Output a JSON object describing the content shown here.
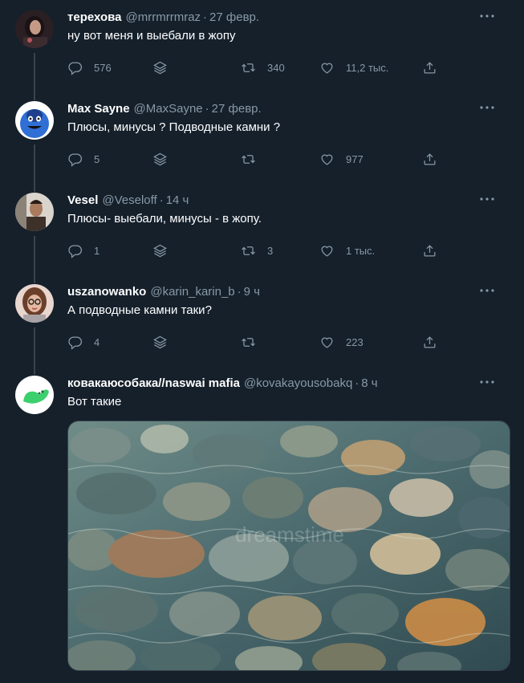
{
  "tweets": [
    {
      "display_name": "терехова",
      "handle": "@mrrmrrmraz",
      "dot": "·",
      "time": "27 февр.",
      "text": "ну вот меня и выебали в жопу",
      "reply_count": "576",
      "retweet_count": "340",
      "like_count": "11,2 тыс.",
      "avatar_color": "#3a2b2b"
    },
    {
      "display_name": "Max Sayne",
      "handle": "@MaxSayne",
      "dot": "·",
      "time": "27 февр.",
      "text": "Плюсы, минусы ? Подводные камни ?",
      "reply_count": "5",
      "retweet_count": "",
      "like_count": "977",
      "avatar_color": "#2f6fd6"
    },
    {
      "display_name": "Vesel",
      "handle": "@Veseloff",
      "dot": "·",
      "time": "14 ч",
      "text": "Плюсы- выебали, минусы - в жопу.",
      "reply_count": "1",
      "retweet_count": "3",
      "like_count": "1 тыс.",
      "avatar_color": "#5a4a3a"
    },
    {
      "display_name": "uszanowanko",
      "handle": "@karin_karin_b",
      "dot": "·",
      "time": "9 ч",
      "text": "А подводные камни таки?",
      "reply_count": "4",
      "retweet_count": "",
      "like_count": "223",
      "avatar_color": "#6b4a3a"
    },
    {
      "display_name": "ковакаюсобака//naswai mafia",
      "handle": "@kovakayousobakq",
      "dot": "·",
      "time": "8 ч",
      "text": "Вот такие",
      "avatar_color": "#ffffff"
    }
  ],
  "media": {
    "watermark": "dreamstime",
    "water_color": "#4b6a6e"
  }
}
